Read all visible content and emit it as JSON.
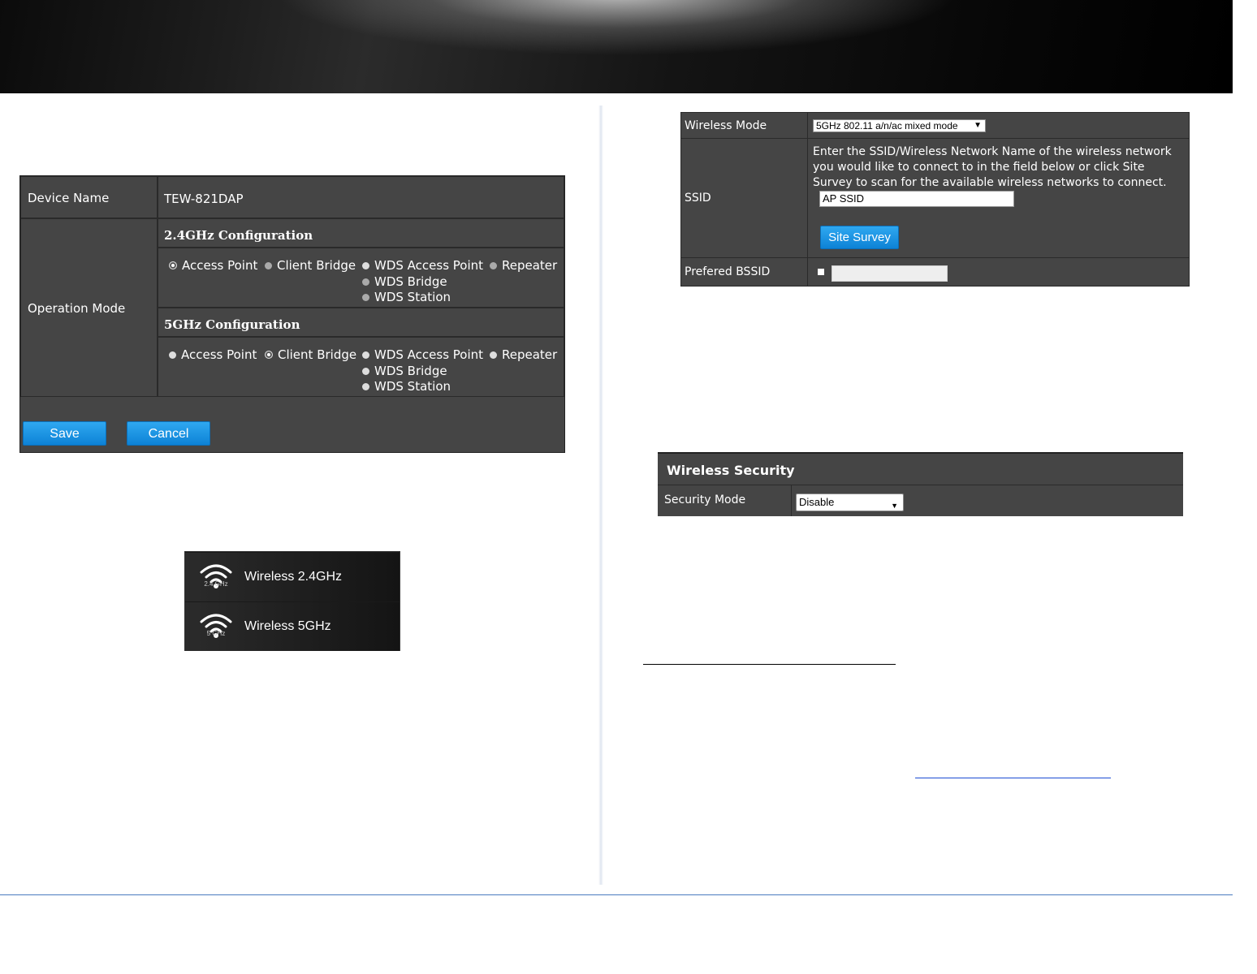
{
  "operation_mode_panel": {
    "device_name_label": "Device Name",
    "device_name_value": "TEW-821DAP",
    "operation_mode_label": "Operation Mode",
    "config_24_title": "2.4GHz Configuration",
    "config_5_title": "5GHz Configuration",
    "options": [
      "Access Point",
      "Client Bridge",
      "WDS Access Point",
      "Repeater",
      "WDS Bridge",
      "WDS Station"
    ],
    "selected_24": "Access Point",
    "selected_5": "Client Bridge",
    "save_label": "Save",
    "cancel_label": "Cancel"
  },
  "wireless_menu": {
    "items": [
      {
        "label": "Wireless 2.4GHz",
        "icon": "wifi-icon",
        "band": "2.4 GHz"
      },
      {
        "label": "Wireless 5GHz",
        "icon": "wifi-icon",
        "band": "5 GHz"
      }
    ]
  },
  "wireless_table": {
    "wireless_mode_label": "Wireless Mode",
    "wireless_mode_value": "5GHz 802.11 a/n/ac mixed mode",
    "ssid_label": "SSID",
    "ssid_help": "Enter the SSID/Wireless Network Name of the wireless network you would like to connect to in the field below or click Site Survey to scan for the available wireless networks to connect.",
    "ssid_value": "AP SSID",
    "site_survey_label": "Site Survey",
    "bssid_label": "Prefered BSSID",
    "bssid_value": ""
  },
  "security": {
    "title": "Wireless Security",
    "mode_label": "Security Mode",
    "mode_value": "Disable"
  },
  "colors": {
    "panel": "#454545",
    "button": "#1a95e3",
    "footer_line": "#4a7ac0"
  }
}
